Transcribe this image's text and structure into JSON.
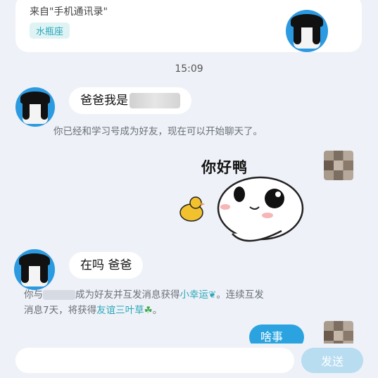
{
  "profile": {
    "source": "来自\"手机通讯录\"",
    "zodiac": "水瓶座"
  },
  "chat": {
    "time": "15:09",
    "msg1": "爸爸我是",
    "system1": "你已经和学习号成为好友，现在可以开始聊天了。",
    "sticker_text": "你好鸭",
    "msg2": "在吗 爸爸",
    "system2": {
      "part1": "你与",
      "part2": "成为好友并互发消息获得",
      "link1": "小幸运",
      "part3": "。连续互发",
      "part4": "消息7天，将获得",
      "link2": "友谊三叶草",
      "part5": "。"
    },
    "reply": "啥事"
  },
  "composer": {
    "placeholder": "",
    "send_label": "发送"
  },
  "colors": {
    "accent": "#2aa3e0",
    "link": "#2aa7b8",
    "background": "#eef1f7"
  }
}
